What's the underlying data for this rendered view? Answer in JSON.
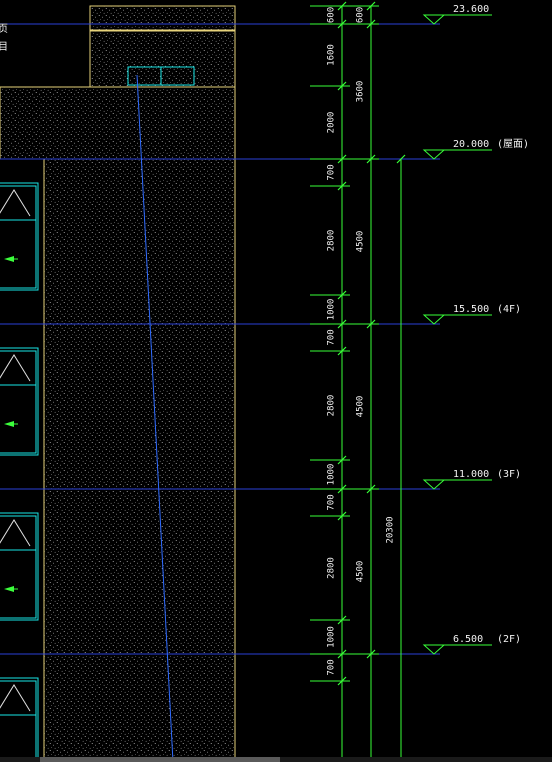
{
  "colors": {
    "background": "#000000",
    "dimension_line": "#39ff39",
    "level_line": "#2a3fd6",
    "building_outline": "#e6d27a",
    "window_frame": "#19e6e6",
    "hatch_dot": "#d9d9d9",
    "text": "#f2f2f2",
    "marker": "#3cff3c",
    "slanted_line": "#2f6bff"
  },
  "levels": [
    {
      "name": "level-23600",
      "value": "23.600",
      "suffix": ""
    },
    {
      "name": "level-20000",
      "value": "20.000",
      "suffix": "(屋面)"
    },
    {
      "name": "level-15500",
      "value": "15.500",
      "suffix": "(4F)"
    },
    {
      "name": "level-11000",
      "value": "11.000",
      "suffix": "(3F)"
    },
    {
      "name": "level-6500",
      "value": "6.500",
      "suffix": "(2F)"
    }
  ],
  "dimensions": {
    "col1": [
      "600",
      "1600",
      "2000",
      "700",
      "2800",
      "1000",
      "700",
      "2800",
      "1000",
      "700",
      "2800",
      "1000",
      "700"
    ],
    "col2": [
      "600",
      "3600",
      "4500",
      "4500",
      "4500"
    ],
    "col3": [
      "20300"
    ]
  },
  "left_fragment_labels": [
    "页",
    "目"
  ],
  "icons": {
    "window_marker": "green-arrow-icon",
    "level_marker": "triangle-level-icon"
  }
}
